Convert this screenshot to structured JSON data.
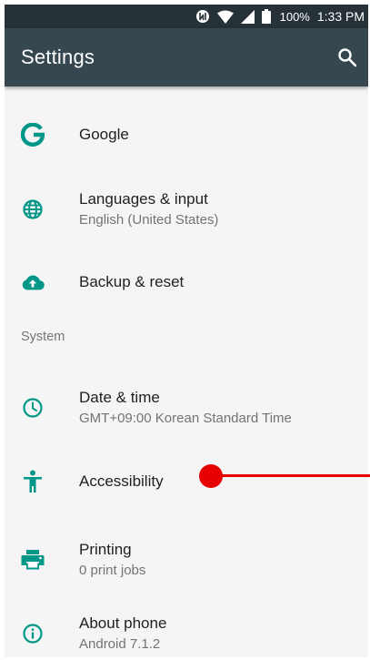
{
  "status_bar": {
    "battery_percent": "100%",
    "time": "1:33 PM"
  },
  "toolbar": {
    "title": "Settings"
  },
  "settings_items": [
    {
      "title": "Google",
      "icon": "google-g-icon"
    },
    {
      "title": "Languages & input",
      "subtitle": "English (United States)",
      "icon": "globe-icon"
    },
    {
      "title": "Backup & reset",
      "icon": "cloud-upload-icon"
    }
  ],
  "system_section": {
    "header": "System",
    "items": [
      {
        "title": "Date & time",
        "subtitle": "GMT+09:00 Korean Standard Time",
        "icon": "clock-icon"
      },
      {
        "title": "Accessibility",
        "icon": "accessibility-icon"
      },
      {
        "title": "Printing",
        "subtitle": "0 print jobs",
        "icon": "printer-icon"
      },
      {
        "title": "About phone",
        "subtitle": "Android 7.1.2",
        "icon": "info-icon"
      }
    ]
  },
  "colors": {
    "status_bar": "#263238",
    "toolbar": "#37474f",
    "icon_accent": "#009688",
    "background": "#f5f5f5",
    "pointer": "#e60000"
  }
}
